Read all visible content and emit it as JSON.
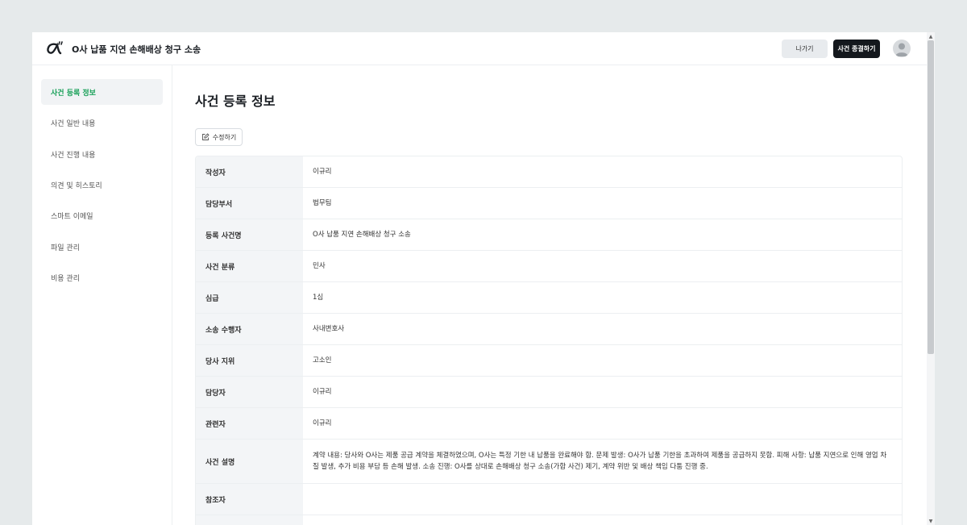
{
  "header": {
    "case_title": "O사 납품 지연 손해배상 청구 소송",
    "exit_label": "나가기",
    "close_case_label": "사건 종결하기"
  },
  "sidebar": {
    "items": [
      {
        "label": "사건 등록 정보",
        "active": true
      },
      {
        "label": "사건 일반 내용"
      },
      {
        "label": "사건 진행 내용"
      },
      {
        "label": "의견 및 히스토리"
      },
      {
        "label": "스마트 이메일"
      },
      {
        "label": "파일 관리"
      },
      {
        "label": "비용 관리"
      }
    ]
  },
  "main": {
    "title": "사건 등록 정보",
    "edit_label": "수정하기",
    "rows": [
      {
        "label": "작성자",
        "value": "이규리"
      },
      {
        "label": "담당부서",
        "value": "법무팀"
      },
      {
        "label": "등록 사건명",
        "value": "O사 납품 지연 손해배상 청구 소송"
      },
      {
        "label": "사건 분류",
        "value": "민사"
      },
      {
        "label": "심급",
        "value": "1심"
      },
      {
        "label": "소송 수행자",
        "value": "사내변호사"
      },
      {
        "label": "당사 지위",
        "value": "고소인"
      },
      {
        "label": "담당자",
        "value": "이규리"
      },
      {
        "label": "관련자",
        "value": "이규리"
      },
      {
        "label": "사건 설명",
        "value": "계약 내용: 당사와 O사는 제품 공급 계약을 체결하였으며, O사는 특정 기한 내 납품을 완료해야 함. 문제 발생: O사가 납품 기한을 초과하여 제품을 공급하지 못함. 피해 사항: 납품 지연으로 인해 영업 차질 발생, 추가 비용 부담 등 손해 발생. 소송 진행: O사를 상대로 손해배상 청구 소송(가합 사건) 제기, 계약 위반 및 배상 책임 다툼 진행 중."
      },
      {
        "label": "참조자",
        "value": ""
      }
    ]
  },
  "colors": {
    "accent_green": "#18a058",
    "dark_button": "#14181d",
    "label_bg": "#f3f5f7"
  },
  "icons": {
    "logo": "alpha-logo",
    "edit": "pencil-square-icon",
    "avatar": "user-avatar-icon"
  }
}
